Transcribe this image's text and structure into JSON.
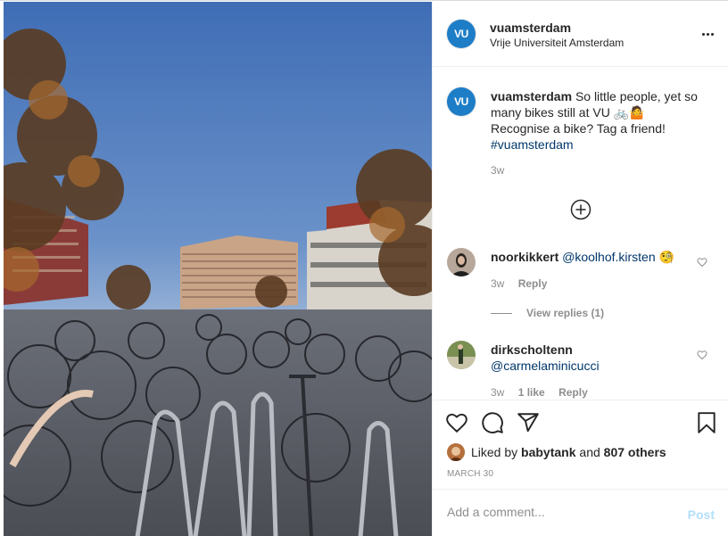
{
  "post": {
    "username": "vuamsterdam",
    "subtitle": "Vrije Universiteit Amsterdam",
    "avatar_text": "VU",
    "more_icon": "more-horizontal-icon"
  },
  "caption": {
    "username": "vuamsterdam",
    "text": "So little people, yet so many bikes still at VU 🚲🤷",
    "line2": "Recognise a bike? Tag a friend!",
    "hashtag": "#vuamsterdam",
    "time": "3w"
  },
  "comments": [
    {
      "username": "noorkikkert",
      "mention": "@koolhof.kirsten",
      "emoji": "🧐",
      "time": "3w",
      "reply_label": "Reply",
      "view_replies": "View replies (1)"
    },
    {
      "username": "dirkscholtenn",
      "mention": "@carmelaminicucci",
      "time": "3w",
      "likes": "1 like",
      "reply_label": "Reply"
    }
  ],
  "likes": {
    "prefix": "Liked by",
    "user": "babytank",
    "and": "and",
    "others": "807 others"
  },
  "date": "MARCH 30",
  "add_comment": {
    "placeholder": "Add a comment...",
    "post_label": "Post"
  },
  "colors": {
    "brand_blue": "#1e7dc7",
    "link": "#00376b",
    "muted": "#8e8e8e",
    "post_disabled": "#b2dffc"
  }
}
